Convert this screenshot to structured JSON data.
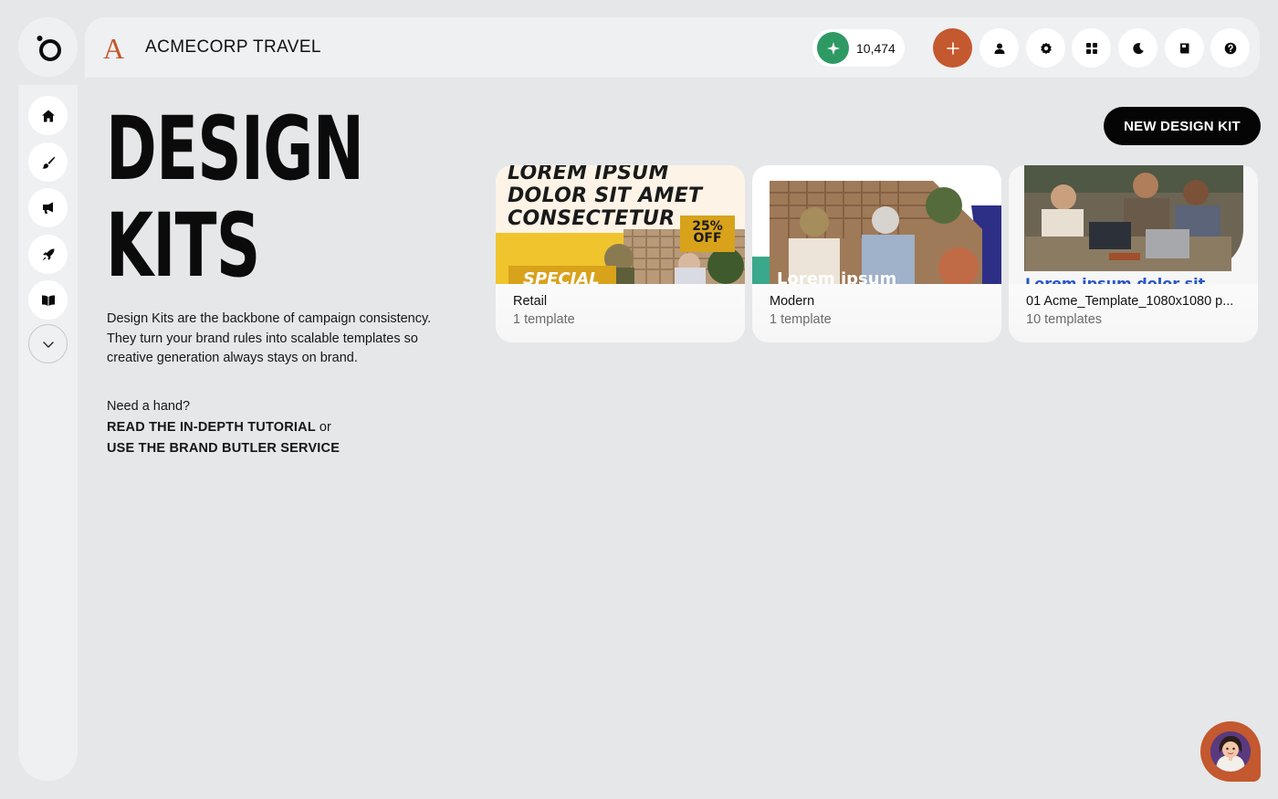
{
  "app": {
    "brand_initial": "A",
    "brand_name": "ACMECORP TRAVEL",
    "accent_color": "#c4582f",
    "credits_color": "#2e9a63"
  },
  "header": {
    "credits": "10,474",
    "buttons": [
      {
        "name": "add",
        "icon": "plus-icon"
      },
      {
        "name": "profile",
        "icon": "user-icon"
      },
      {
        "name": "settings",
        "icon": "gear-icon"
      },
      {
        "name": "apps",
        "icon": "grid-icon"
      },
      {
        "name": "dark-mode",
        "icon": "moon-icon"
      },
      {
        "name": "guide",
        "icon": "book-icon"
      },
      {
        "name": "help",
        "icon": "question-icon"
      }
    ]
  },
  "sidebar": {
    "items": [
      {
        "name": "home",
        "icon": "home-icon"
      },
      {
        "name": "create",
        "icon": "brush-icon"
      },
      {
        "name": "campaigns",
        "icon": "megaphone-icon"
      },
      {
        "name": "launch",
        "icon": "rocket-icon"
      },
      {
        "name": "library",
        "icon": "open-book-icon"
      },
      {
        "name": "more",
        "icon": "chevron-down-icon"
      }
    ]
  },
  "main": {
    "title_line1": "DESIGN",
    "title_line2": "KITS",
    "description": "Design Kits are the backbone of campaign consistency. They turn your brand rules into scalable templates so creative generation always stays on brand.",
    "help_prompt": "Need a hand?",
    "tutorial_link": "READ THE IN-DEPTH TUTORIAL",
    "or_text": " or",
    "butler_link": "USE THE BRAND BUTLER SERVICE",
    "new_kit_button": "NEW DESIGN KIT"
  },
  "kits": [
    {
      "name": "Retail",
      "count": "1 template",
      "thumb_text": "LOREM IPSUM\nDOLOR SIT AMET\nCONSECTETUR",
      "badge": "25%\nOFF",
      "special": "SPECIAL"
    },
    {
      "name": "Modern",
      "count": "1 template",
      "thumb_text": "Lorem ipsum"
    },
    {
      "name": "01 Acme_Template_1080x1080 p...",
      "count": "10 templates",
      "thumb_text": "Lorem ipsum dolor sit"
    }
  ]
}
